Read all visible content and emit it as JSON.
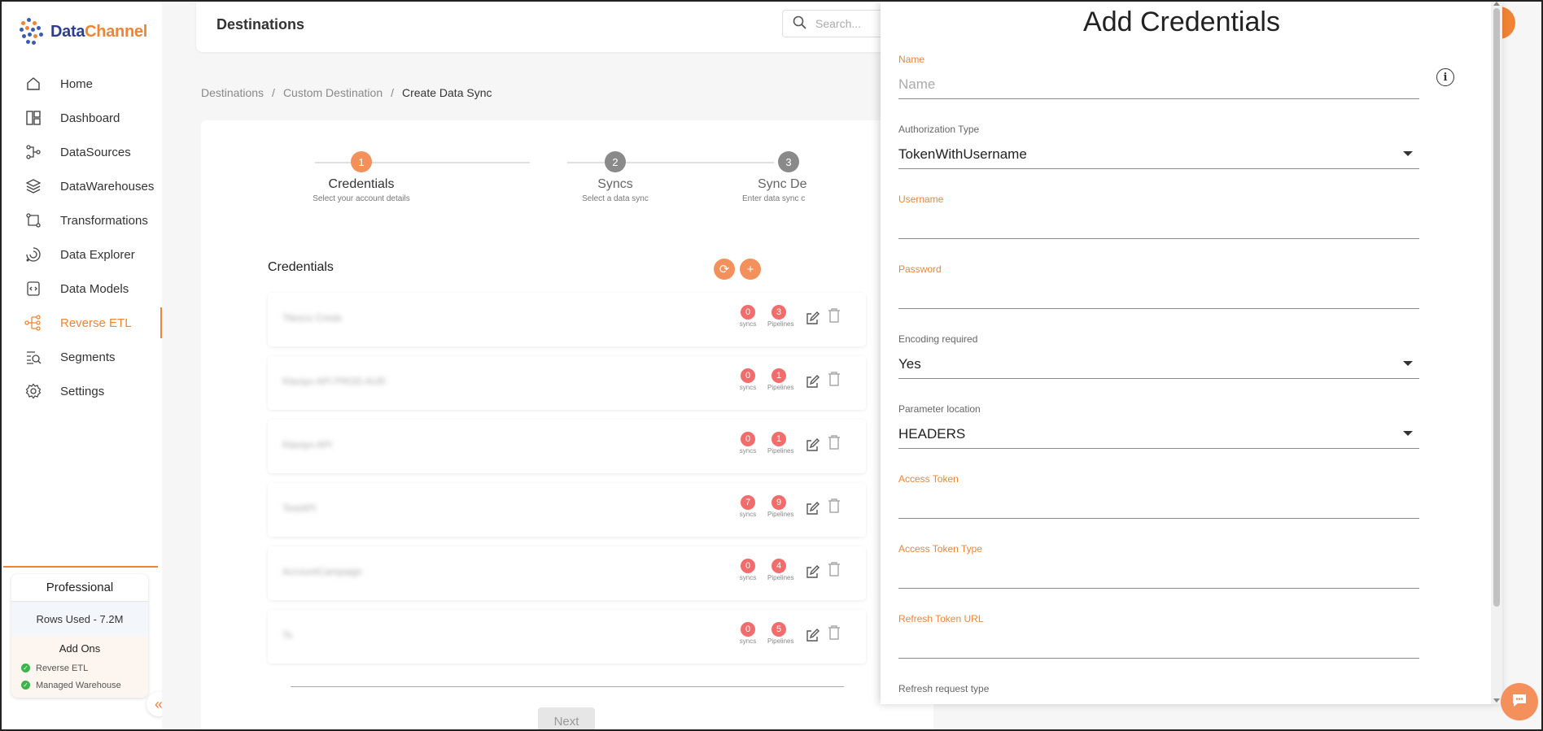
{
  "brand": {
    "name_part1": "Data",
    "name_part2": "Channel"
  },
  "sidebar": {
    "items": [
      {
        "label": "Home",
        "icon": "home-icon"
      },
      {
        "label": "Dashboard",
        "icon": "dashboard-icon"
      },
      {
        "label": "DataSources",
        "icon": "datasources-icon"
      },
      {
        "label": "DataWarehouses",
        "icon": "layers-icon"
      },
      {
        "label": "Transformations",
        "icon": "transform-icon"
      },
      {
        "label": "Data Explorer",
        "icon": "explorer-icon"
      },
      {
        "label": "Data Models",
        "icon": "code-file-icon"
      },
      {
        "label": "Reverse ETL",
        "icon": "reverse-etl-icon",
        "active": true
      },
      {
        "label": "Segments",
        "icon": "segments-icon"
      },
      {
        "label": "Settings",
        "icon": "gear-icon"
      }
    ],
    "plan": {
      "title": "Professional",
      "rows_used": "Rows Used - 7.2M",
      "addons_title": "Add Ons",
      "addons": [
        "Reverse ETL",
        "Managed Warehouse"
      ]
    }
  },
  "header": {
    "title": "Destinations",
    "search_placeholder": "Search..."
  },
  "breadcrumb": [
    "Destinations",
    "/",
    "Custom Destination",
    "/",
    "Create Data Sync"
  ],
  "stepper": {
    "steps": [
      {
        "num": "1",
        "name": "Credentials",
        "desc": "Select your account details",
        "state": "active"
      },
      {
        "num": "2",
        "name": "Syncs",
        "desc": "Select a data sync",
        "state": "pending"
      },
      {
        "num": "3",
        "name": "Sync De",
        "desc": "Enter data sync c",
        "state": "pending"
      }
    ]
  },
  "credentials": {
    "title": "Credentials",
    "syncs_label": "syncs",
    "pipelines_label": "Pipelines",
    "rows": [
      {
        "name": "Tilesco Creds",
        "syncs": "0",
        "pipelines": "3"
      },
      {
        "name": "Klaviyo API PROD AUR",
        "syncs": "0",
        "pipelines": "1"
      },
      {
        "name": "Klaviyo API",
        "syncs": "0",
        "pipelines": "1"
      },
      {
        "name": "TestAPI",
        "syncs": "7",
        "pipelines": "9"
      },
      {
        "name": "AccountCampaign",
        "syncs": "0",
        "pipelines": "4"
      },
      {
        "name": "Ts",
        "syncs": "0",
        "pipelines": "5"
      }
    ],
    "next_label": "Next"
  },
  "drawer": {
    "title": "Add Credentials",
    "fields": [
      {
        "label": "Name",
        "value": "",
        "placeholder": "Name",
        "type": "text",
        "label_color": "orange"
      },
      {
        "label": "Authorization Type",
        "value": "TokenWithUsername",
        "type": "select",
        "label_color": "grey"
      },
      {
        "label": "Username",
        "value": "",
        "type": "text",
        "label_color": "orange"
      },
      {
        "label": "Password",
        "value": "",
        "type": "text",
        "label_color": "orange"
      },
      {
        "label": "Encoding required",
        "value": "Yes",
        "type": "select",
        "label_color": "grey"
      },
      {
        "label": "Parameter location",
        "value": "HEADERS",
        "type": "select",
        "label_color": "grey"
      },
      {
        "label": "Access Token",
        "value": "",
        "type": "text",
        "label_color": "orange"
      },
      {
        "label": "Access Token Type",
        "value": "",
        "type": "text",
        "label_color": "orange"
      },
      {
        "label": "Refresh Token URL",
        "value": "",
        "type": "text",
        "label_color": "orange"
      },
      {
        "label": "Refresh request type",
        "value": "",
        "type": "text",
        "label_color": "grey"
      }
    ]
  },
  "colors": {
    "accent": "#f08433",
    "badge": "#f26c6c",
    "brand_blue": "#2c3e8f",
    "check_green": "#3bb54a"
  }
}
